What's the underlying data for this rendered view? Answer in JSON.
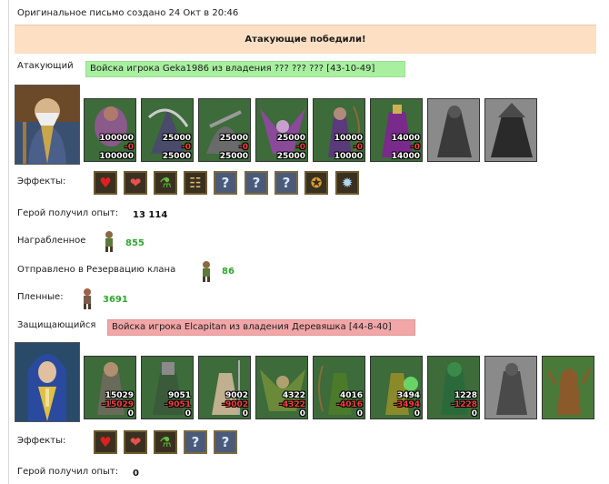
{
  "letter": {
    "created": "Оригинальное письмо создано 24 Окт в 20:46"
  },
  "result": "Атакующие победили!",
  "attacker": {
    "label": "Атакующий",
    "army": "Войска игрока Geka1986 из владения ??? ??? ??? [43-10-49]",
    "units": [
      {
        "start": "100000",
        "lost": "-0",
        "remain": "100000"
      },
      {
        "start": "25000",
        "lost": "-0",
        "remain": "25000"
      },
      {
        "start": "25000",
        "lost": "-0",
        "remain": "25000"
      },
      {
        "start": "25000",
        "lost": "-0",
        "remain": "25000"
      },
      {
        "start": "10000",
        "lost": "-0",
        "remain": "10000"
      },
      {
        "start": "14000",
        "lost": "-0",
        "remain": "14000"
      }
    ],
    "effects_label": "Эффекты:",
    "effects": [
      "heart-icon",
      "hearts-icon",
      "potion-icon",
      "scroll-icon",
      "?",
      "?",
      "?",
      "gold-icon",
      "crystal-icon"
    ],
    "exp_label": "Герой получил опыт:",
    "exp_value": "13 114",
    "loot_label": "Награбленное",
    "loot_value": "855",
    "clan_label": "Отправлено в Резервацию клана",
    "clan_value": "86",
    "captives_label": "Пленные:",
    "captives_value": "3691"
  },
  "defender": {
    "label": "Защищающийся",
    "army": "Войска игрока Elcapitan из владения Деревяшка [44-8-40]",
    "units": [
      {
        "start": "15029",
        "lost": "-15029",
        "remain": "0"
      },
      {
        "start": "9051",
        "lost": "-9051",
        "remain": "0"
      },
      {
        "start": "9002",
        "lost": "-9002",
        "remain": "0"
      },
      {
        "start": "4322",
        "lost": "-4322",
        "remain": "0"
      },
      {
        "start": "4016",
        "lost": "-4016",
        "remain": "0"
      },
      {
        "start": "3494",
        "lost": "-3494",
        "remain": "0"
      },
      {
        "start": "1228",
        "lost": "-1228",
        "remain": "0"
      }
    ],
    "effects_label": "Эффекты:",
    "effects": [
      "heart-icon",
      "hearts-icon",
      "potion-icon",
      "?",
      "?"
    ],
    "exp_label": "Герой получил опыт:",
    "exp_value": "0"
  }
}
